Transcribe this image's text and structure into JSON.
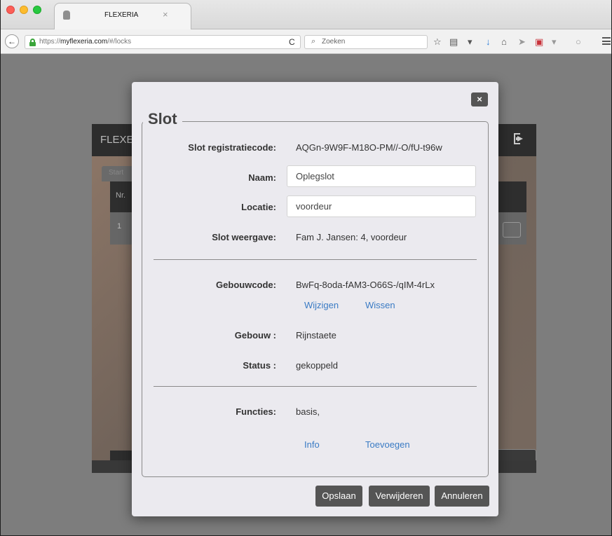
{
  "browser": {
    "tab_title": "FLEXERIA",
    "tab_close": "×",
    "url_scheme": "https://",
    "url_host": "myflexeria.com",
    "url_path": "/#/locks",
    "search_placeholder": "Zoeken",
    "reload_glyph": "C"
  },
  "app": {
    "brand": "FLEXERIA",
    "tab_label": "Start",
    "table_header_nr": "Nr.",
    "row_nr": "1"
  },
  "modal": {
    "close_label": "×",
    "legend": "Slot",
    "fields": {
      "registratiecode_label": "Slot registratiecode:",
      "registratiecode_value": "AQGn-9W9F-M18O-PM//-O/fU-t96w",
      "naam_label": "Naam:",
      "naam_value": "Oplegslot",
      "locatie_label": "Locatie:",
      "locatie_value": "voordeur",
      "weergave_label": "Slot weergave:",
      "weergave_value": "Fam J. Jansen: 4, voordeur",
      "gebouwcode_label": "Gebouwcode:",
      "gebouwcode_value": "BwFq-8oda-fAM3-O66S-/qIM-4rLx",
      "wijzigen_link": "Wijzigen",
      "wissen_link": "Wissen",
      "gebouw_label": "Gebouw :",
      "gebouw_value": "Rijnstaete",
      "status_label": "Status :",
      "status_value": "gekoppeld",
      "functies_label": "Functies:",
      "functies_value": "basis,",
      "info_link": "Info",
      "toevoegen_link": "Toevoegen"
    },
    "buttons": {
      "save": "Opslaan",
      "delete": "Verwijderen",
      "cancel": "Annuleren"
    }
  },
  "colors": {
    "link": "#3a7bc4",
    "button": "#555555",
    "overlay": "#7d7d7d",
    "modal_bg": "#ebeaef"
  }
}
